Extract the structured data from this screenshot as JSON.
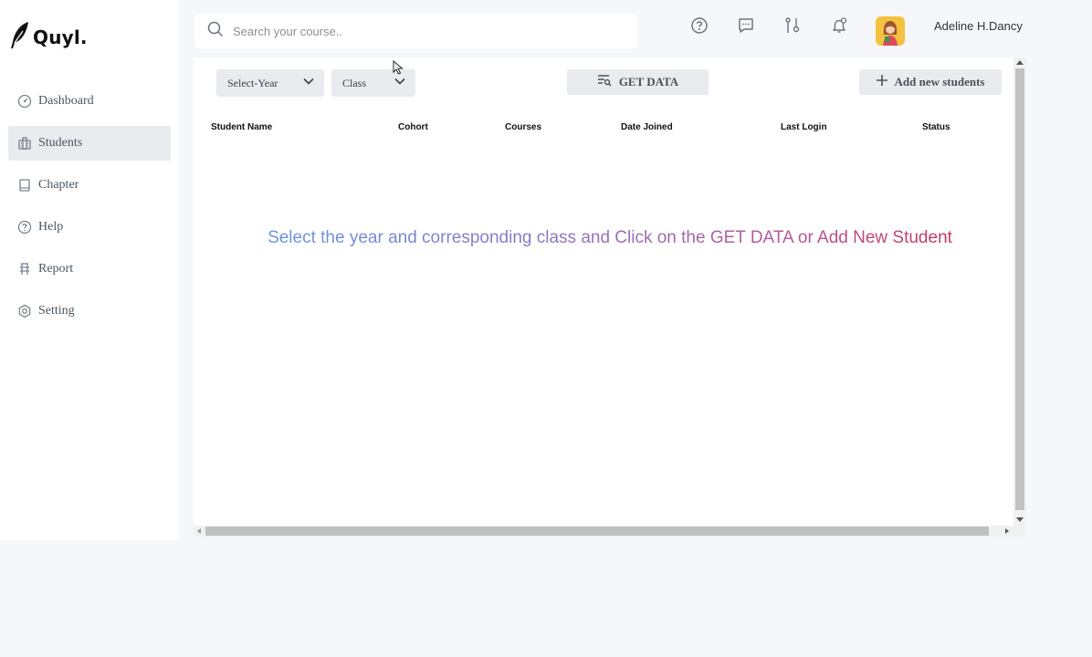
{
  "brand": {
    "name": "Quyl."
  },
  "sidebar": {
    "items": [
      {
        "label": "Dashboard",
        "icon": "dashboard-icon",
        "active": false
      },
      {
        "label": "Students",
        "icon": "students-icon",
        "active": true
      },
      {
        "label": "Chapter",
        "icon": "book-icon",
        "active": false
      },
      {
        "label": "Help",
        "icon": "help-icon",
        "active": false
      },
      {
        "label": "Report",
        "icon": "report-icon",
        "active": false
      },
      {
        "label": "Setting",
        "icon": "settings-icon",
        "active": false
      }
    ]
  },
  "header": {
    "search_placeholder": "Search your course..",
    "icons": [
      "help-icon",
      "chat-icon",
      "filter-icon",
      "notification-icon"
    ],
    "user_name": "Adeline H.Dancy"
  },
  "filters": {
    "year_label": "Select-Year",
    "class_label": "Class"
  },
  "actions": {
    "get_data_label": "GET DATA",
    "add_students_label": "Add new students"
  },
  "table": {
    "columns": [
      "Student Name",
      "Cohort",
      "Courses",
      "Date Joined",
      "Last Login",
      "Status"
    ],
    "rows": []
  },
  "empty_message": "Select the year and corresponding class and Click on the GET DATA or Add New Student",
  "colors": {
    "background": "#f6f7fa",
    "active_nav": "#e9ebef",
    "gradient_start": "#5f9fe0",
    "gradient_end": "#c8284a"
  }
}
